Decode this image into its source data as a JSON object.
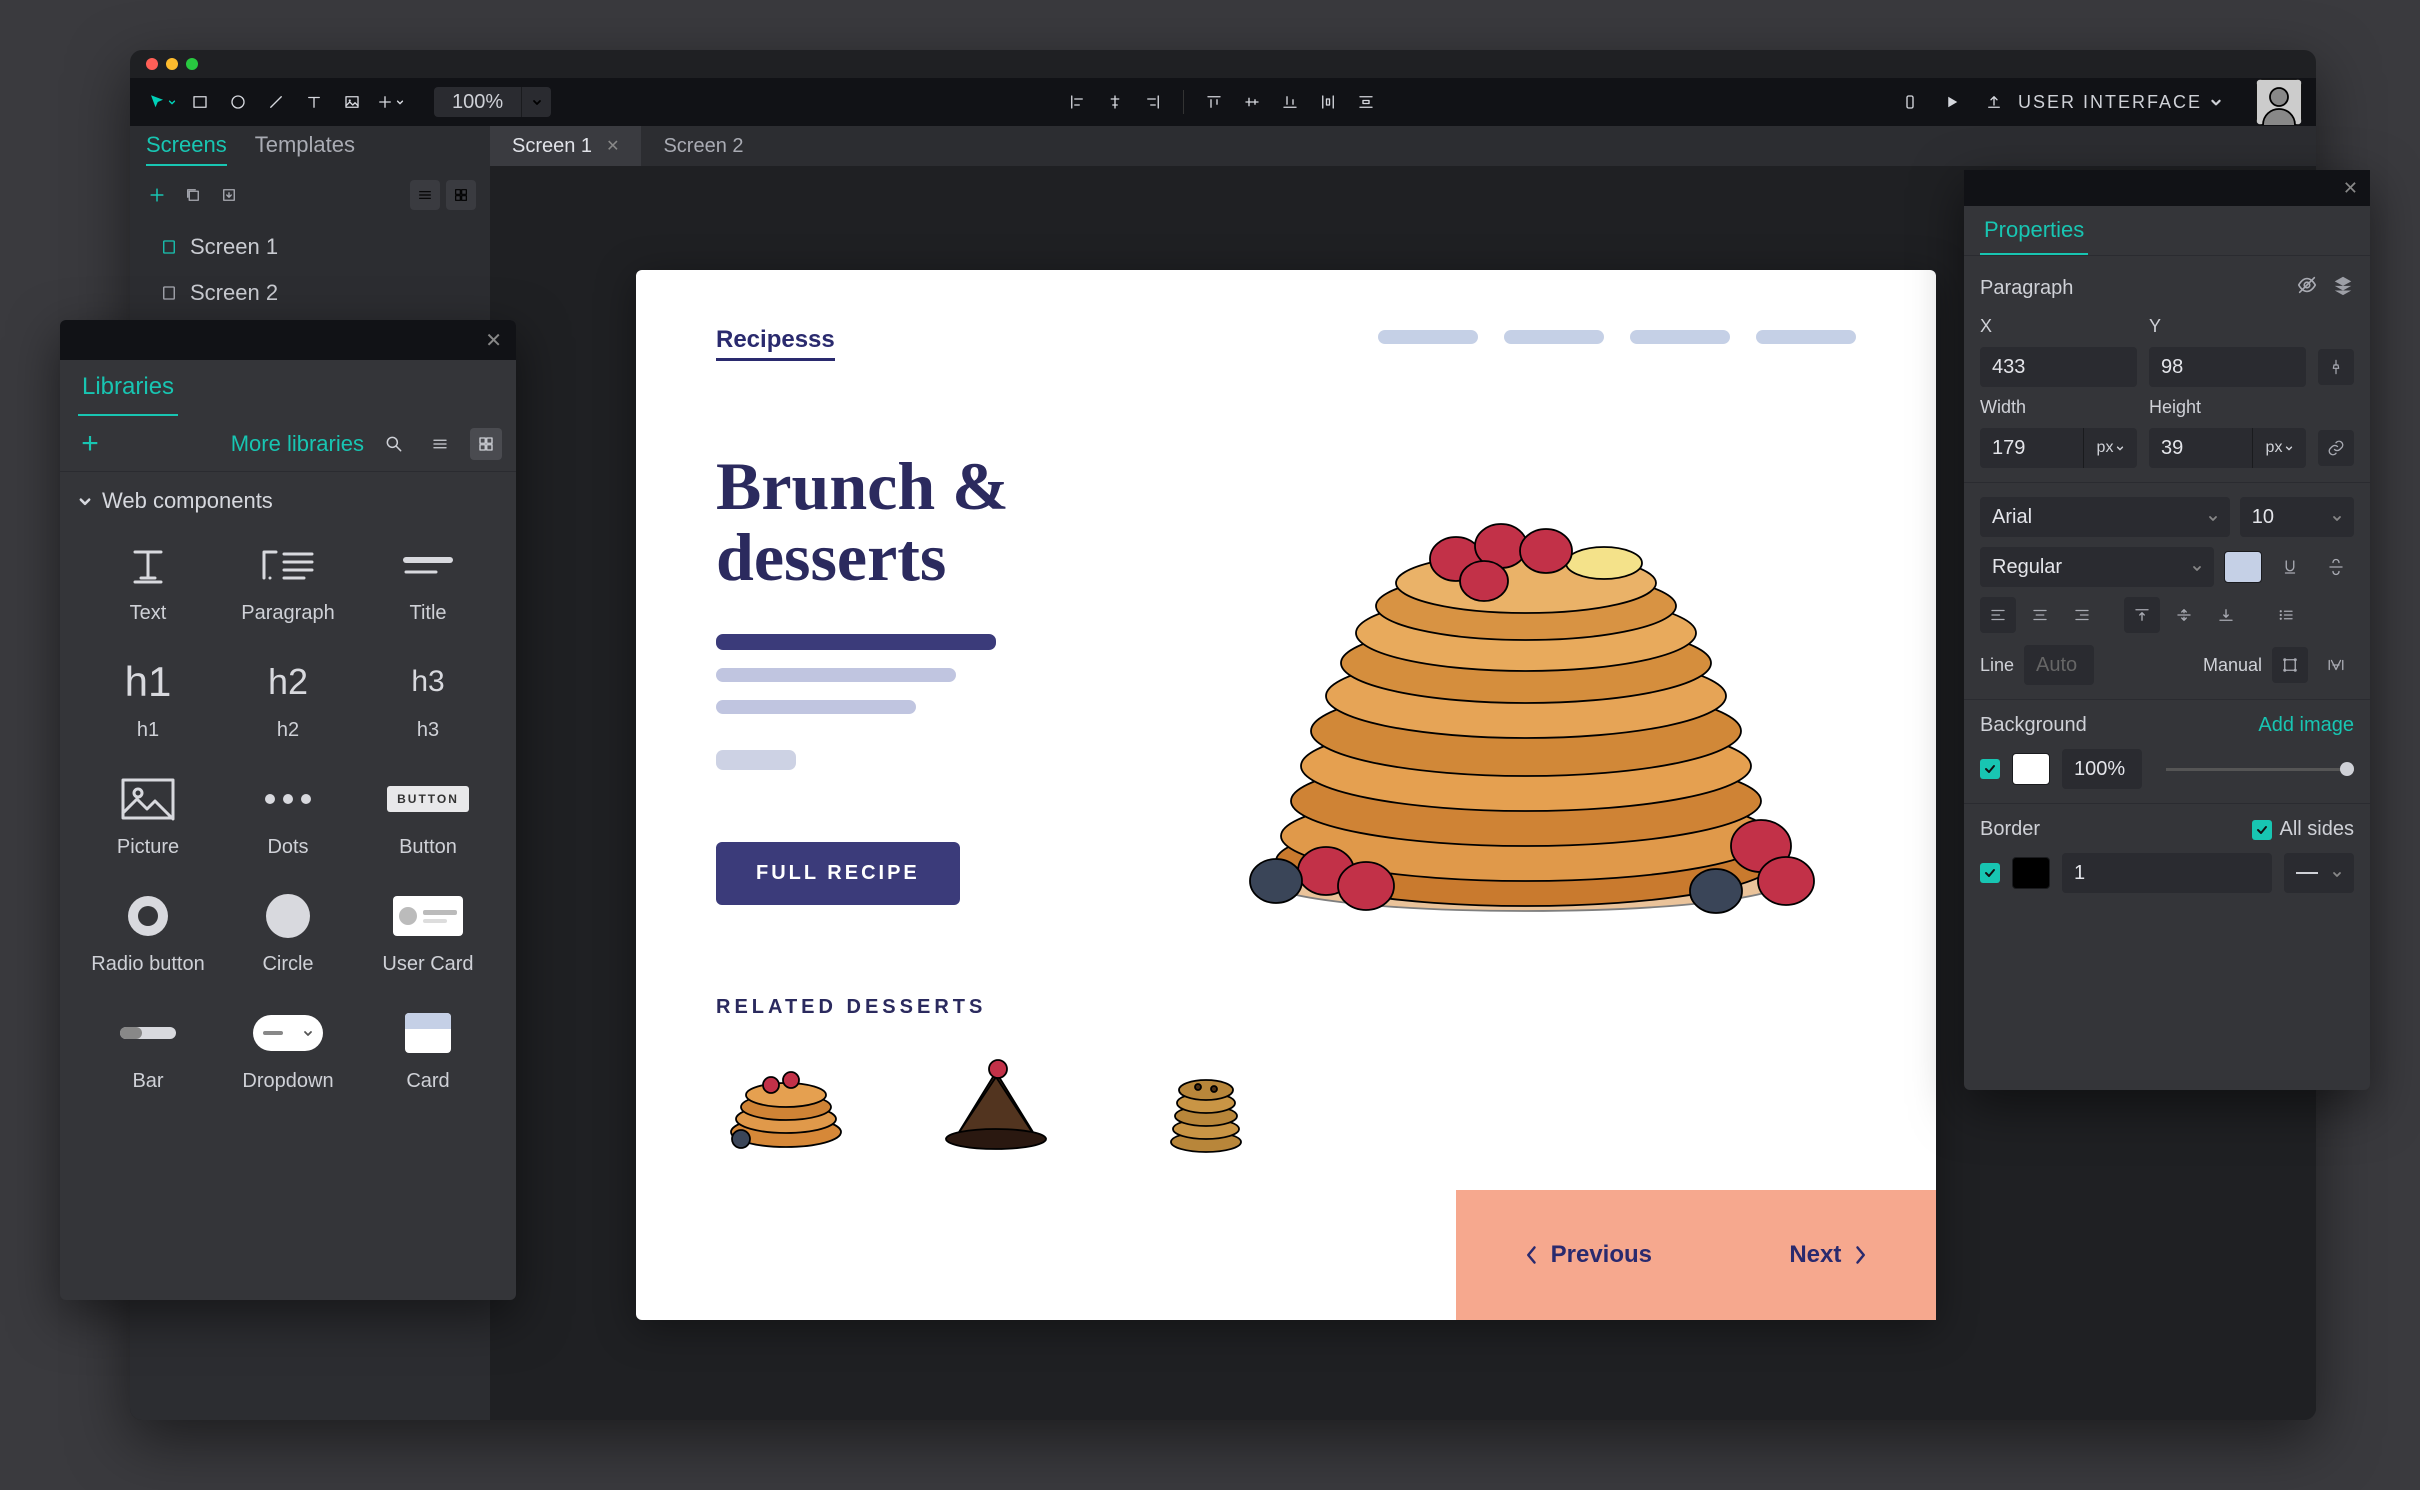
{
  "toolbar": {
    "zoom": "100%",
    "project_label": "USER INTERFACE"
  },
  "sidebar": {
    "tabs": {
      "screens": "Screens",
      "templates": "Templates"
    },
    "screens": [
      "Screen 1",
      "Screen 2"
    ]
  },
  "screen_tabs": [
    {
      "label": "Screen 1",
      "active": true
    },
    {
      "label": "Screen 2",
      "active": false
    }
  ],
  "libraries": {
    "title": "Libraries",
    "more": "More libraries",
    "section": "Web components",
    "items": {
      "text": "Text",
      "paragraph": "Paragraph",
      "title": "Title",
      "h1": "h1",
      "h2": "h2",
      "h3": "h3",
      "h1_g": "h1",
      "h2_g": "h2",
      "h3_g": "h3",
      "picture": "Picture",
      "dots": "Dots",
      "button": "Button",
      "button_chip": "BUTTON",
      "radio": "Radio button",
      "circle": "Circle",
      "usercard": "User Card",
      "bar": "Bar",
      "dropdown": "Dropdown",
      "card": "Card"
    }
  },
  "artboard": {
    "brand": "Recipesss",
    "hero_title": "Brunch & desserts",
    "cta": "FULL RECIPE",
    "related_label": "RELATED DESSERTS",
    "prev": "Previous",
    "next": "Next"
  },
  "properties": {
    "title": "Properties",
    "element": "Paragraph",
    "x_label": "X",
    "y_label": "Y",
    "x": "433",
    "y": "98",
    "w_label": "Width",
    "h_label": "Height",
    "w": "179",
    "h": "39",
    "unit": "px",
    "font": "Arial",
    "font_size": "10",
    "weight": "Regular",
    "line_label": "Line",
    "line_auto": "Auto",
    "manual_label": "Manual",
    "bg_label": "Background",
    "add_image": "Add image",
    "opacity": "100%",
    "border_label": "Border",
    "all_sides": "All sides",
    "border_w": "1"
  }
}
